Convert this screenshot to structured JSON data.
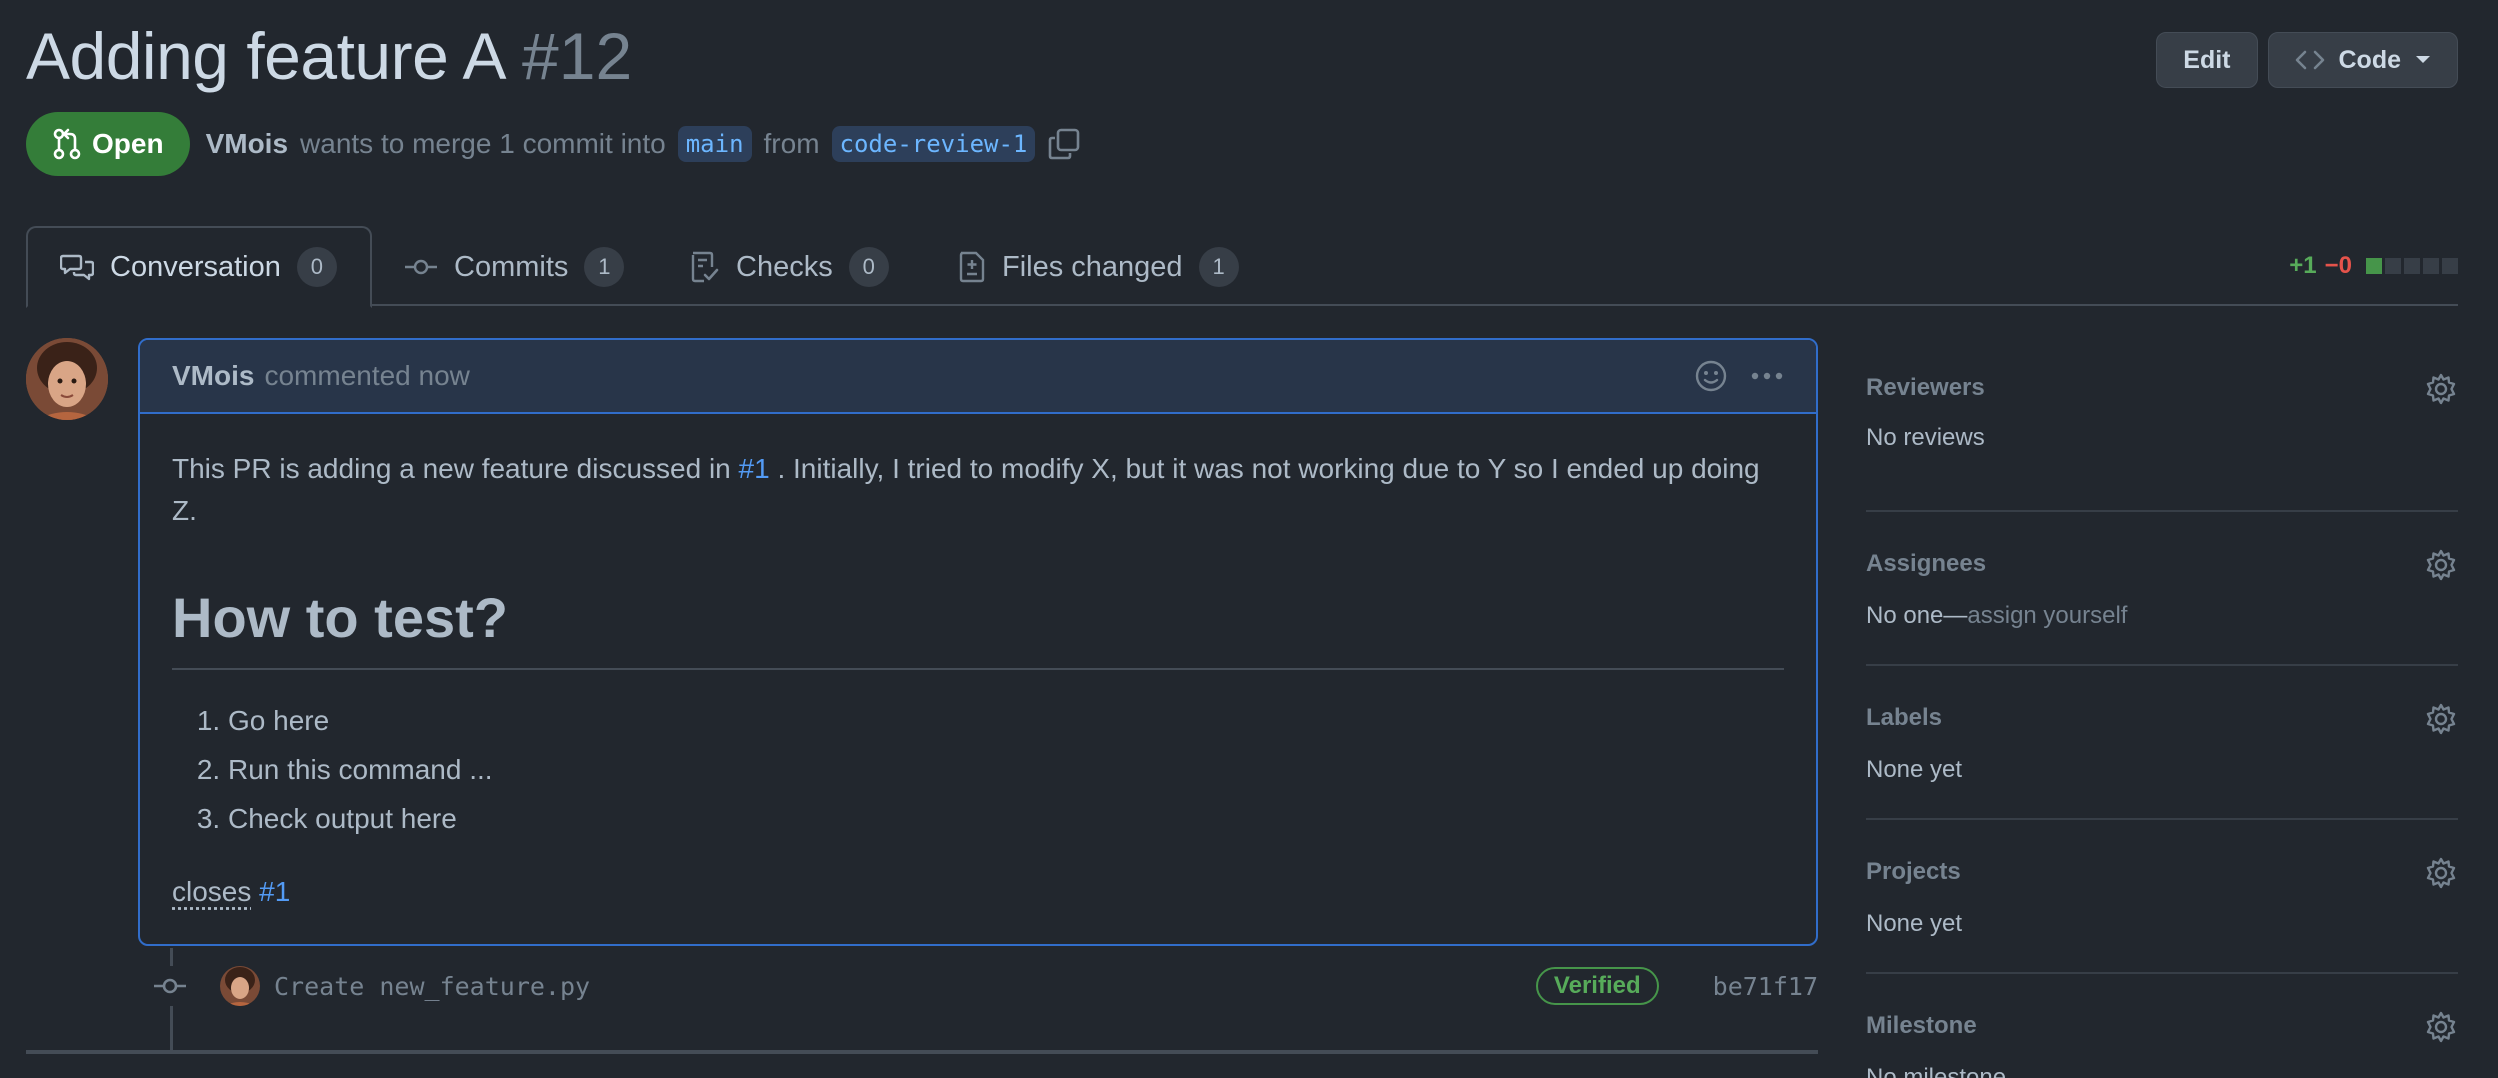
{
  "header": {
    "title": "Adding feature A",
    "number": "#12",
    "edit_label": "Edit",
    "code_label": "Code"
  },
  "meta": {
    "state": "Open",
    "author": "VMois",
    "text_before": "wants to merge 1 commit into",
    "base_branch": "main",
    "text_from": "from",
    "head_branch": "code-review-1"
  },
  "tabs": [
    {
      "label": "Conversation",
      "count": "0",
      "icon": "comment-discussion-icon"
    },
    {
      "label": "Commits",
      "count": "1",
      "icon": "git-commit-icon"
    },
    {
      "label": "Checks",
      "count": "0",
      "icon": "checklist-icon"
    },
    {
      "label": "Files changed",
      "count": "1",
      "icon": "file-diff-icon"
    }
  ],
  "diffstat": {
    "additions": "+1",
    "deletions": "−0"
  },
  "comment": {
    "author": "VMois",
    "action": "commented now",
    "body_before_link": "This PR is adding a new feature discussed in",
    "issue_link": "#1",
    "body_after_link": ". Initially, I tried to modify X, but it was not working due to Y so I ended up doing Z.",
    "heading": "How to test?",
    "steps": [
      "Go here",
      "Run this command ...",
      "Check output here"
    ],
    "closes_keyword": "closes",
    "closes_link": "#1"
  },
  "commit": {
    "message": "Create new_feature.py",
    "verified": "Verified",
    "sha": "be71f17"
  },
  "sidebar": {
    "reviewers": {
      "title": "Reviewers",
      "value": "No reviews"
    },
    "assignees": {
      "title": "Assignees",
      "value": "No one—",
      "action": "assign yourself"
    },
    "labels": {
      "title": "Labels",
      "value": "None yet"
    },
    "projects": {
      "title": "Projects",
      "value": "None yet"
    },
    "milestone": {
      "title": "Milestone",
      "value": "No milestone"
    }
  },
  "colors": {
    "background": "#22272e",
    "open_green": "#347d39",
    "accent_blue": "#539bf5",
    "border_blue": "#316dca"
  }
}
